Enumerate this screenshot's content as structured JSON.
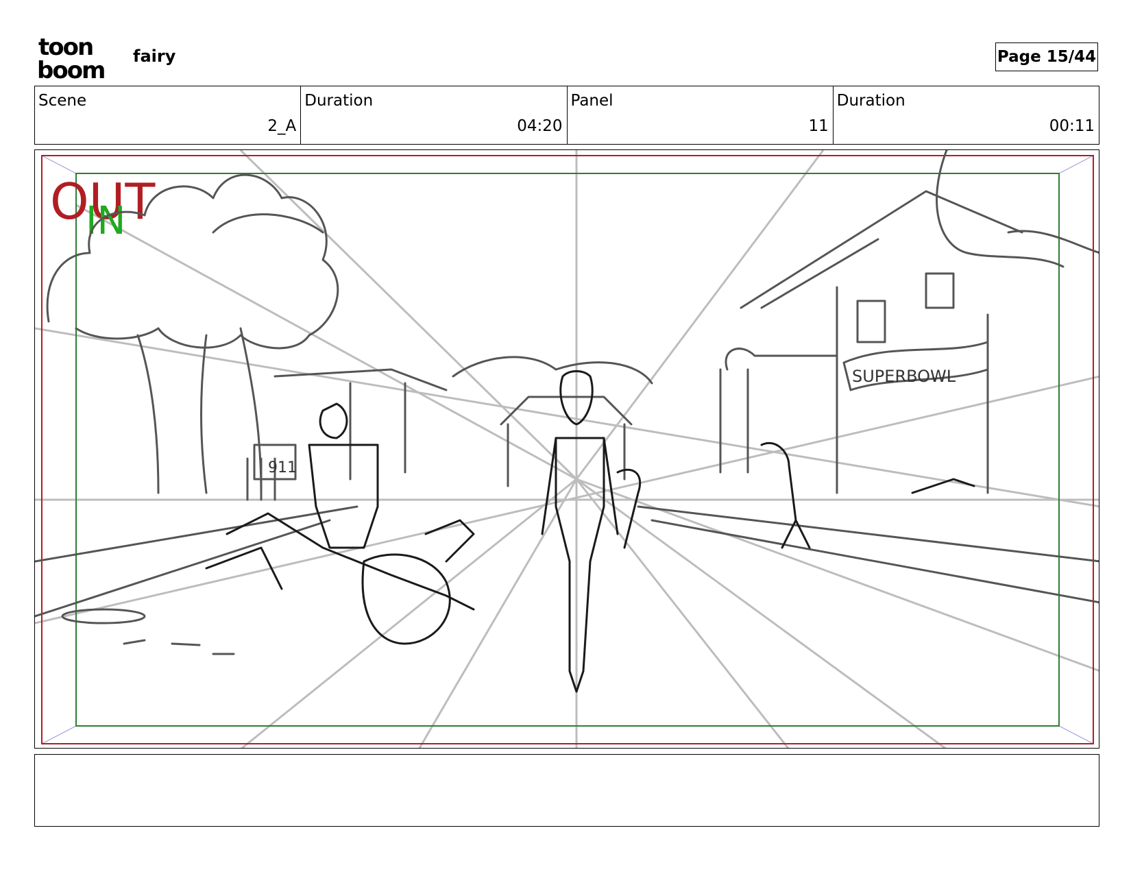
{
  "header": {
    "logo_lines": [
      "toon",
      "boom"
    ],
    "project_title": "fairy",
    "page_label": "Page 15/44"
  },
  "info": {
    "scene_label": "Scene",
    "scene_value": "2_A",
    "scene_duration_label": "Duration",
    "scene_duration_value": "04:20",
    "panel_label": "Panel",
    "panel_value": "11",
    "panel_duration_label": "Duration",
    "panel_duration_value": "00:11"
  },
  "panel": {
    "out_label": "OUT",
    "in_label": "IN",
    "banner_text": "SUPERBOWL",
    "sign_text": "911",
    "colors": {
      "out_frame": "#b01e23",
      "in_frame": "#2e7d32",
      "in_label": "#1faa1f",
      "sketch": "#1a1a1a",
      "perspective": "#bdbdbd"
    }
  },
  "notes": {
    "text": ""
  }
}
